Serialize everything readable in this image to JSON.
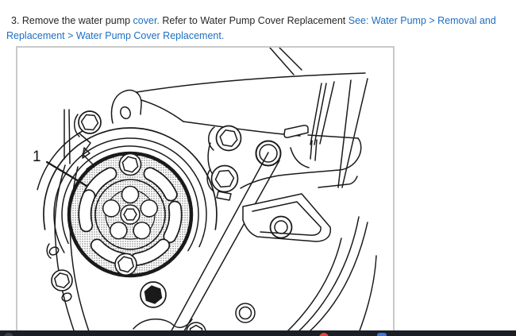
{
  "instruction": {
    "segments": [
      {
        "text": "3. Remove the water pump ",
        "type": "text"
      },
      {
        "text": "cover.",
        "type": "link"
      },
      {
        "text": " Refer to Water Pump Cover Replacement ",
        "type": "text"
      },
      {
        "text": "See: Water Pump > Removal and Replacement > Water Pump Cover Replacement.",
        "type": "link"
      }
    ]
  },
  "figure": {
    "callout_label": "1",
    "description": "Engine front line drawing showing water pump pulley (item 1)",
    "border_color": "#c9c9c9",
    "line_color": "#1a1a1a"
  },
  "colors": {
    "link_blue": "#1d6fc2",
    "body_text": "#262626",
    "background": "#ffffff",
    "taskbar": "#1b1e24",
    "taskbar_icon_red": "#e0473a",
    "taskbar_icon_blue": "#3f73d6"
  }
}
